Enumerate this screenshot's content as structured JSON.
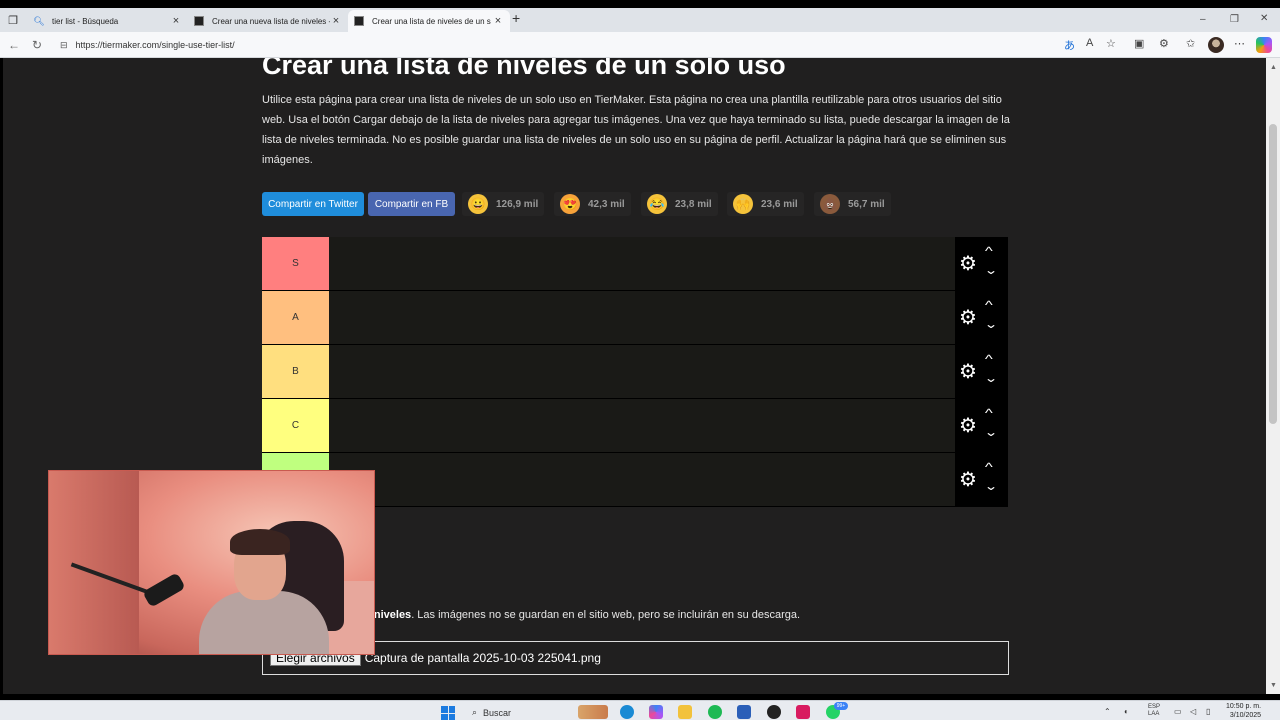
{
  "browser": {
    "tabs": [
      {
        "title": "tier list - Búsqueda",
        "active": false
      },
      {
        "title": "Crear una nueva lista de niveles -",
        "active": false
      },
      {
        "title": "Crear una lista de niveles de un s",
        "active": true
      }
    ],
    "url": "https://tiermaker.com/single-use-tier-list/"
  },
  "page": {
    "title": "Crear una lista de niveles de un solo uso",
    "description": "Utilice esta página para crear una lista de niveles de un solo uso en TierMaker. Esta página no crea una plantilla reutilizable para otros usuarios del sitio web. Usa el botón Cargar debajo de la lista de niveles para agregar tus imágenes. Una vez que haya terminado su lista, puede descargar la imagen de la lista de niveles terminada. No es posible guardar una lista de niveles de un solo uso en su página de perfil. Actualizar la página hará que se eliminen sus imágenes.",
    "share_twitter": "Compartir en Twitter",
    "share_fb": "Compartir en FB",
    "reactions": [
      {
        "icon": "grinning-face-icon",
        "emoji": "😀",
        "count": "126,9 mil",
        "color": "#f5c33b"
      },
      {
        "icon": "heart-eyes-icon",
        "emoji": "😍",
        "count": "42,3 mil",
        "color": "#f7a23a"
      },
      {
        "icon": "laughing-face-icon",
        "emoji": "😂",
        "count": "23,8 mil",
        "color": "#f5c33b"
      },
      {
        "icon": "raised-hands-icon",
        "emoji": "🙌",
        "count": "23,6 mil",
        "color": "#f5c33b"
      },
      {
        "icon": "poop-icon",
        "emoji": "💩",
        "count": "56,7 mil",
        "color": "#8a5a3c"
      }
    ],
    "tiers": [
      {
        "label": "S",
        "color": "#ff7f7f"
      },
      {
        "label": "A",
        "color": "#ffbf7f"
      },
      {
        "label": "B",
        "color": "#ffdf7f"
      },
      {
        "label": "C",
        "color": "#ffff7f"
      },
      {
        "label": "",
        "color": "#bfff7f"
      }
    ],
    "upload_note_bold": "usarlas en tu lista de niveles",
    "upload_note_rest": ". Las imágenes no se guardan en el sitio web, pero se incluirán en su descarga.",
    "file_button": "Elegir archivos",
    "file_name": "Captura de pantalla 2025-10-03 225041.png"
  },
  "taskbar": {
    "search_placeholder": "Buscar",
    "badge": "99+",
    "lang_top": "ESP",
    "lang_bottom": "LAA",
    "time": "10:50 p. m.",
    "date": "3/10/2025"
  }
}
